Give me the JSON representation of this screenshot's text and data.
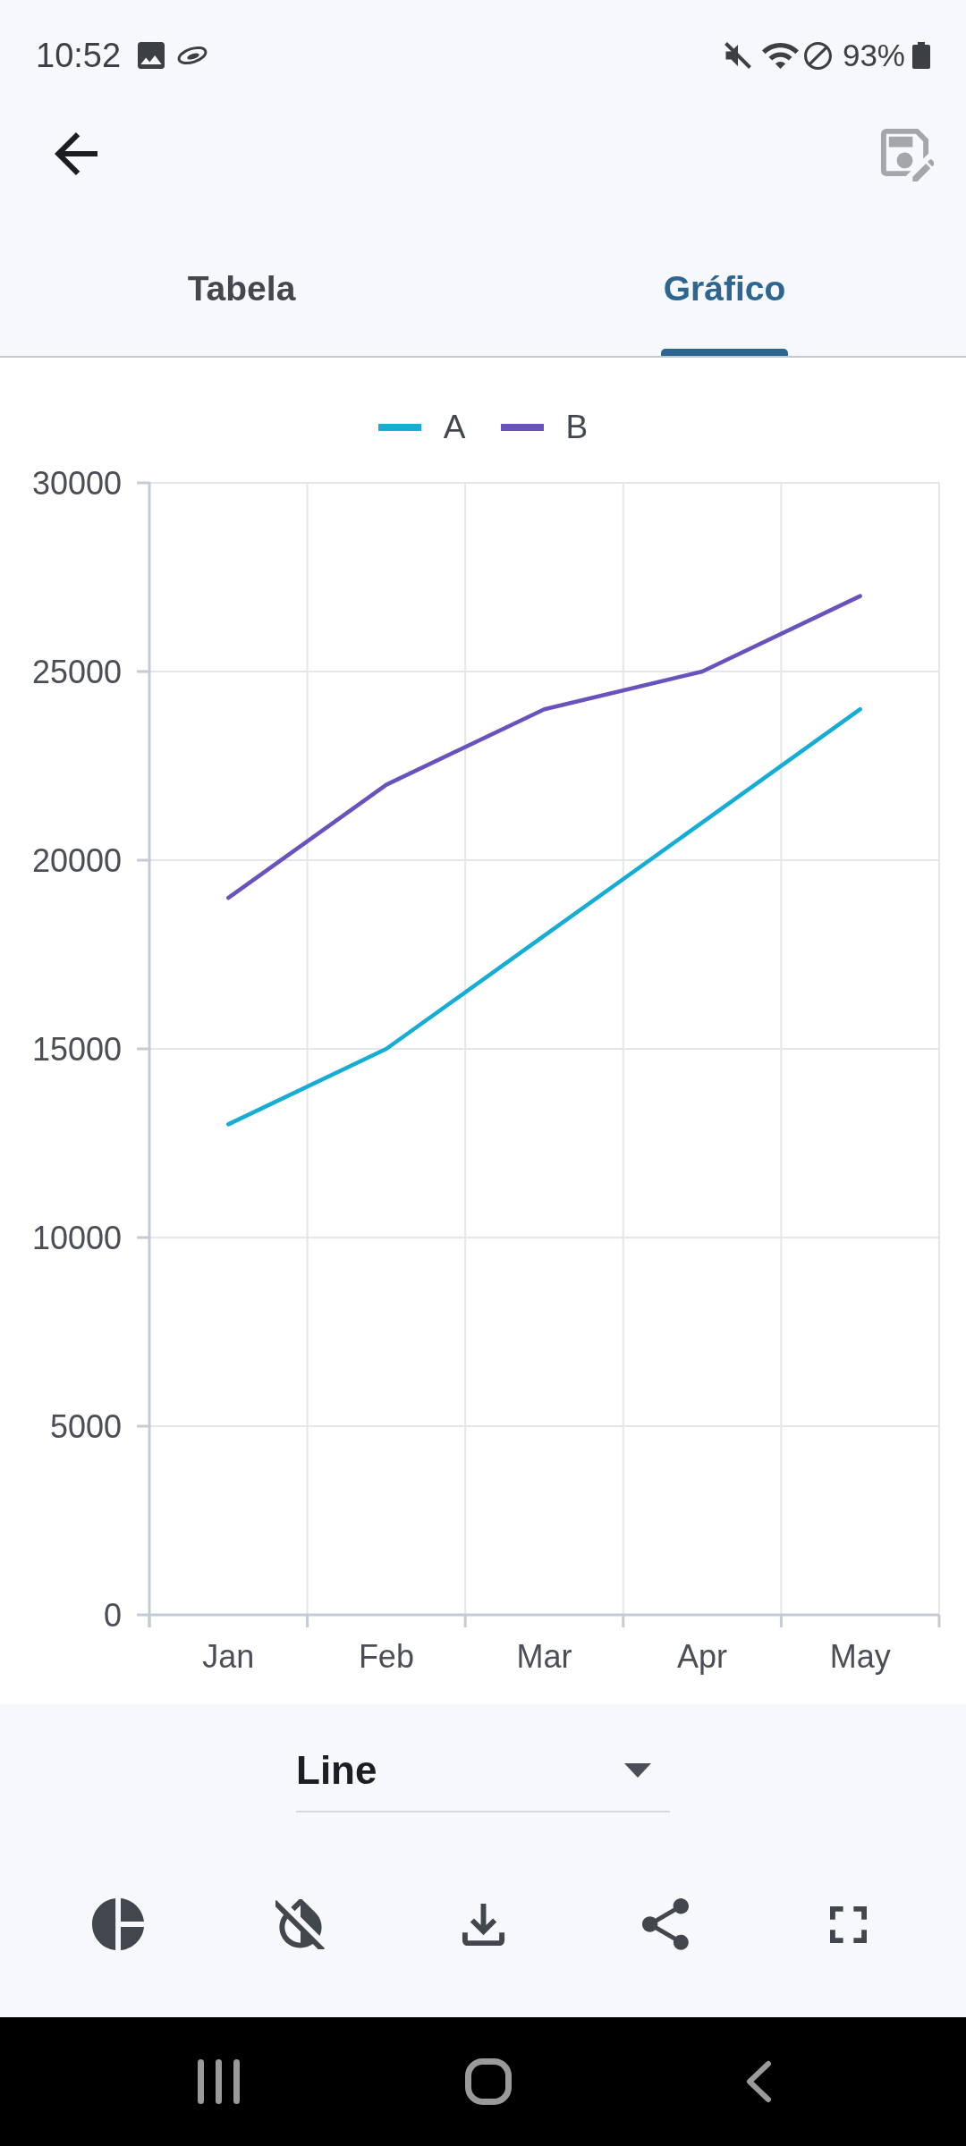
{
  "status_bar": {
    "time": "10:52",
    "battery": "93%"
  },
  "top_bar": {
    "save_button": {
      "disabled": true
    }
  },
  "tabs": [
    {
      "label": "Tabela",
      "selected": false
    },
    {
      "label": "Gráfico",
      "selected": true
    }
  ],
  "chart": {
    "chart_data": {
      "type": "line",
      "categories": [
        "Jan",
        "Feb",
        "Mar",
        "Apr",
        "May"
      ],
      "series": [
        {
          "name": "A",
          "color": "#15acd6",
          "values": [
            13000,
            15000,
            18000,
            21000,
            24000
          ]
        },
        {
          "name": "B",
          "color": "#6a52be",
          "values": [
            19000,
            22000,
            24000,
            25000,
            27000
          ]
        }
      ],
      "ylim": [
        0,
        30000
      ],
      "yticks": [
        0,
        5000,
        10000,
        15000,
        20000,
        25000,
        30000
      ],
      "grid": true,
      "legend": true
    }
  },
  "chart_type_select": {
    "value": "Line"
  }
}
